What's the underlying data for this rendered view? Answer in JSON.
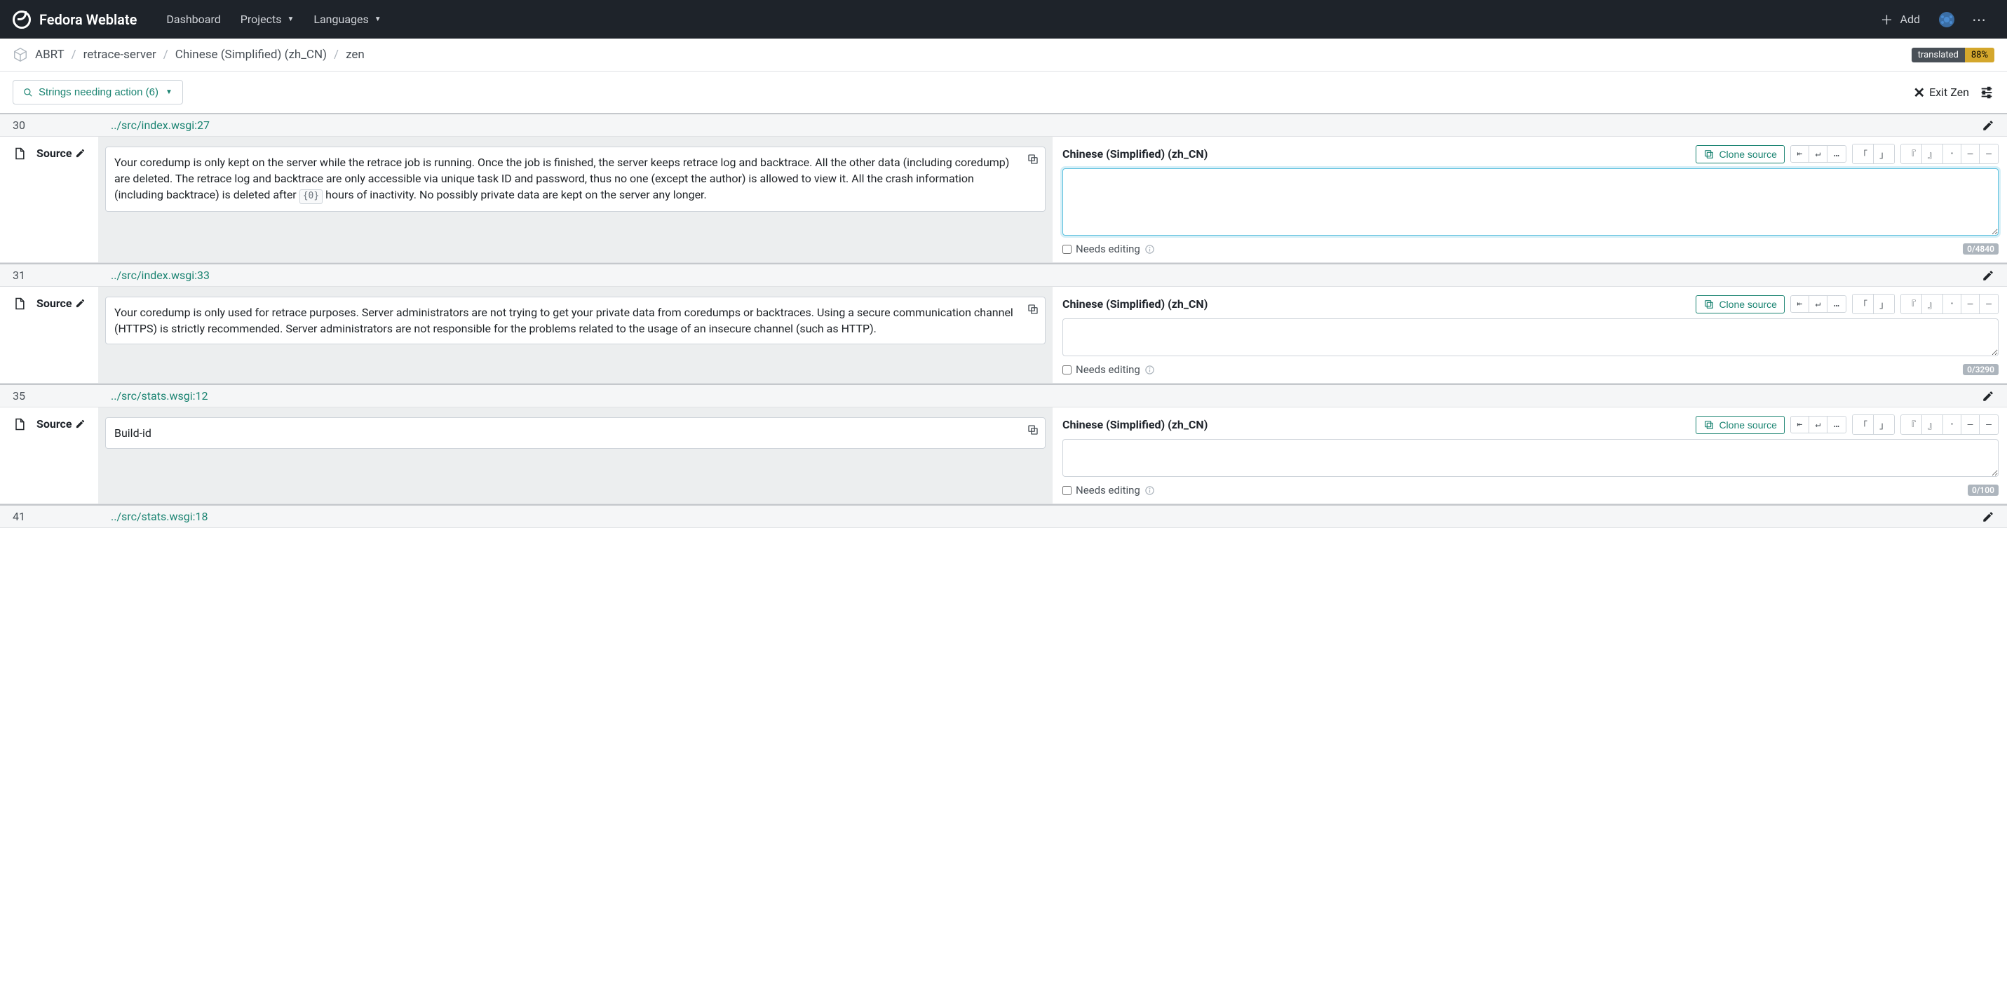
{
  "navbar": {
    "brand": "Fedora Weblate",
    "dashboard": "Dashboard",
    "projects": "Projects",
    "languages": "Languages",
    "add": "Add"
  },
  "breadcrumb": {
    "items": [
      "ABRT",
      "retrace-server",
      "Chinese (Simplified) (zh_CN)",
      "zen"
    ]
  },
  "status": {
    "label": "translated",
    "percent": "88%"
  },
  "filter": {
    "label": "Strings needing action (6)"
  },
  "zen": {
    "exit": "Exit Zen"
  },
  "common": {
    "sourceLabel": "Source",
    "targetLang": "Chinese (Simplified) (zh_CN)",
    "cloneSource": "Clone source",
    "needsEditing": "Needs editing",
    "insertButtons": [
      "⇤",
      "↵",
      "…",
      "「",
      "」",
      "『",
      "』",
      "·",
      "–",
      "—"
    ]
  },
  "strings": [
    {
      "num": "30",
      "loc": "../src/index.wsgi:27",
      "sourceBefore": "Your coredump is only kept on the server while the retrace job is running. Once the job is finished, the server keeps retrace log and backtrace. All the other data (including coredump) are deleted. The retrace log and backtrace are only accessible via unique task ID and password, thus no one (except the author) is allowed to view it. All the crash information (including backtrace) is deleted after ",
      "placeable": "{0}",
      "sourceAfter": " hours of inactivity. No possibly private data are kept on the server any longer.",
      "charCount": "0/4840",
      "focused": true,
      "taHeight": 96
    },
    {
      "num": "31",
      "loc": "../src/index.wsgi:33",
      "sourceBefore": "Your coredump is only used for retrace purposes. Server administrators are not trying to get your private data from coredumps or backtraces. Using a secure communication channel (HTTPS) is strictly recommended. Server administrators are not responsible for the problems related to the usage of an insecure channel (such as HTTP).",
      "placeable": "",
      "sourceAfter": "",
      "charCount": "0/3290",
      "focused": false,
      "taHeight": 54
    },
    {
      "num": "35",
      "loc": "../src/stats.wsgi:12",
      "sourceBefore": "Build-id",
      "placeable": "",
      "sourceAfter": "",
      "charCount": "0/100",
      "focused": false,
      "taHeight": 54
    },
    {
      "num": "41",
      "loc": "../src/stats.wsgi:18",
      "headerOnly": true
    }
  ]
}
